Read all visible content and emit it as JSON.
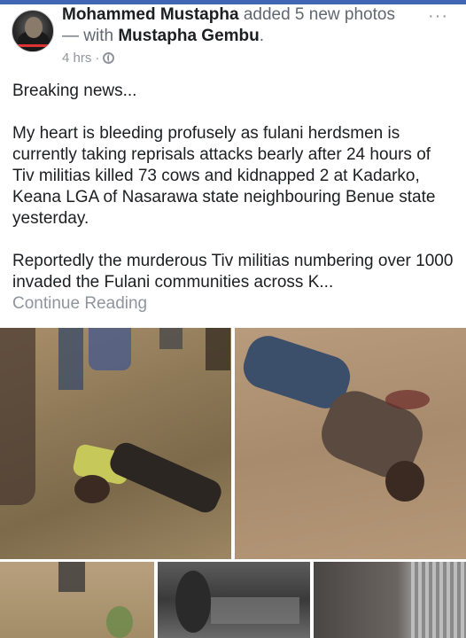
{
  "post": {
    "author": "Mohammed Mustapha",
    "action_text": "added 5 new photos — with",
    "tagged": "Mustapha Gembu",
    "tagged_suffix": ".",
    "time": "4 hrs",
    "separator": "·",
    "privacy_icon": "globe-icon",
    "more_icon": "more-dots-icon",
    "more_label": "···"
  },
  "body": {
    "paragraphs": [
      "Breaking news...",
      "My heart is bleeding profusely as fulani herdsmen is currently taking reprisals attacks bearly after 24 hours of Tiv militias killed 73 cows and kidnapped 2 at Kadarko, Keana LGA of Nasarawa state neighbouring Benue state  yesterday.",
      "Reportedly the murderous Tiv militias numbering over 1000 invaded the Fulani communities across K..."
    ],
    "continue_label": "Continue Reading"
  },
  "colors": {
    "brand_blue": "#4267b2",
    "text": "#1c1e21",
    "muted": "#90949c"
  }
}
